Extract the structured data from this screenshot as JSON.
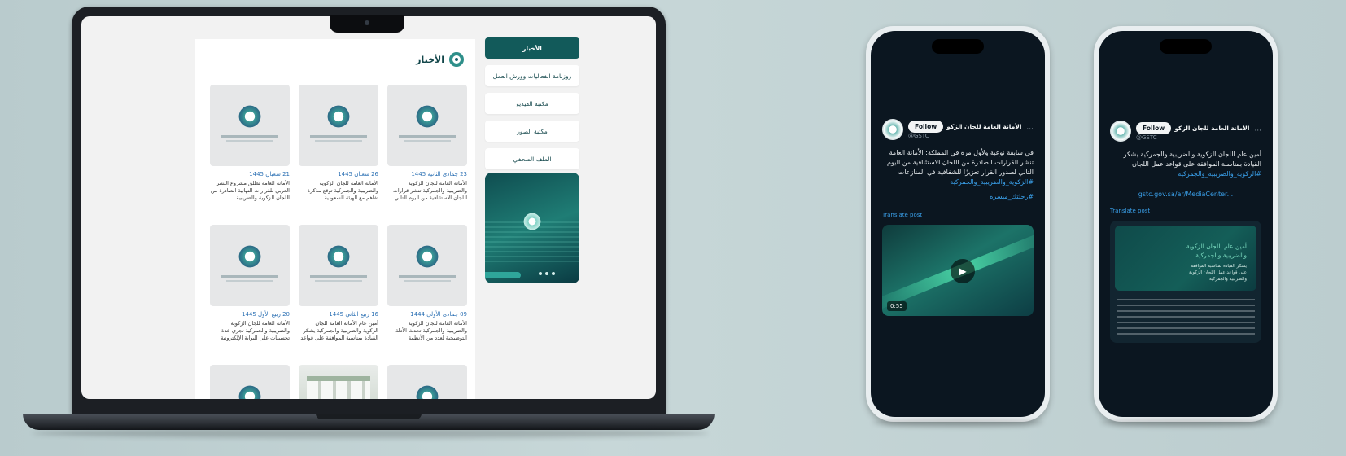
{
  "site": {
    "section_title": "الأخبار",
    "sidebar": [
      {
        "label": "الأخبار",
        "active": true
      },
      {
        "label": "روزنامة الفعاليات وورش العمل",
        "active": false
      },
      {
        "label": "مكتبة الفيديو",
        "active": false
      },
      {
        "label": "مكتبة الصور",
        "active": false
      },
      {
        "label": "الملف الصحفي",
        "active": false
      }
    ],
    "news": [
      {
        "date": "23 جمادى الثانية 1445",
        "excerpt": "الأمانة العامة للجان الزكوية والضريبية والجمركية تنشر قرارات اللجان الاستئنافية من اليوم التالي"
      },
      {
        "date": "26 شعبان 1445",
        "excerpt": "الأمانة العامة للجان الزكوية والضريبية والجمركية توقع مذكرة تفاهم مع الهيئة السعودية"
      },
      {
        "date": "21 شعبان 1445",
        "excerpt": "الأمانة العامة تطلق مشروع النشر العربي للقرارات النهائية الصادرة من اللجان الزكوية والضريبية"
      },
      {
        "date": "09 جمادى الأولى 1444",
        "excerpt": "الأمانة العامة للجان الزكوية والضريبية والجمركية تحدث الأدلة التوضيحية لعدد من الأنظمة"
      },
      {
        "date": "16 ربيع الثاني 1445",
        "excerpt": "أمين عام الأمانة العامة للجان الزكوية والضريبية والجمركية يشكر القيادة بمناسبة الموافقة على قواعد"
      },
      {
        "date": "20 ربيع الأول 1445",
        "excerpt": "الأمانة العامة للجان الزكوية والضريبية والجمركية تجري عدة تحسينات على البوابة الإلكترونية"
      },
      {
        "date": "",
        "excerpt": ""
      },
      {
        "date": "",
        "excerpt": ""
      },
      {
        "date": "",
        "excerpt": ""
      }
    ]
  },
  "phones": [
    {
      "name": "الأمانة العامة للجان الزكوية...",
      "handle": "@GSTC",
      "follow_label": "Follow",
      "more": "···",
      "body": "في سابقة نوعية ولأول مرة في المملكة: الأمانة العامة تنشر القرارات الصادرة من اللجان الاستئنافية من اليوم التالي لصدور القرار تعزيزًا للشفافية في المنازعات",
      "tags": "#الزكوية_والضريبية_والجمركية",
      "tags2": "#رحلتك_ميسرة",
      "translate": "Translate post",
      "video_duration": "0:55"
    },
    {
      "name": "الأمانة العامة للجان الزكوية...",
      "handle": "@GSTC",
      "follow_label": "Follow",
      "more": "···",
      "body": "أمين عام اللجان الزكوية والضريبية والجمركية يشكر القيادة بمناسبة الموافقة على قواعد عمل اللجان",
      "tags": "#الزكوية_والضريبية_والجمركية",
      "link": "gstc.gov.sa/ar/MediaCenter...",
      "translate": "Translate post",
      "card_heading": "أمين عام اللجان الزكوية والضريبية والجمركية",
      "card_text": "يشكر القيادة بمناسبة الموافقة على قواعد عمل اللجان الزكوية والضريبية والجمركية"
    }
  ]
}
